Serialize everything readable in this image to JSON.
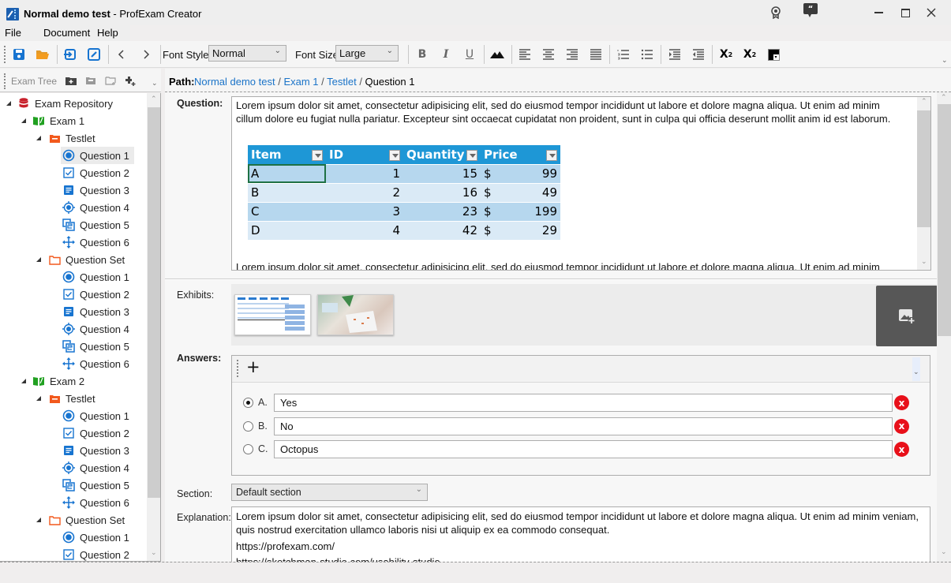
{
  "window": {
    "title_doc": "Normal demo test",
    "title_app": " - ProfExam Creator"
  },
  "menu": [
    "File",
    "Document",
    "Help"
  ],
  "toolbar": {
    "font_style_label": "Font Style:",
    "font_style_value": "Normal",
    "font_size_label": "Font Size:",
    "font_size_value": "Large",
    "bold": "B",
    "italic": "I",
    "underline": "U",
    "subscript": "X",
    "subscript_sub": "2",
    "superscript": "X",
    "superscript_sup": "2"
  },
  "left_panel": {
    "title": "Exam Tree"
  },
  "tree": [
    {
      "label": "Exam Repository",
      "level": 0,
      "icon": "database-icon",
      "expanded": true
    },
    {
      "label": "Exam 1",
      "level": 1,
      "icon": "book-icon",
      "expanded": true
    },
    {
      "label": "Testlet",
      "level": 2,
      "icon": "testlet-folder-icon",
      "expanded": true
    },
    {
      "label": "Question 1",
      "level": 3,
      "icon": "radio-question-icon",
      "selected": true
    },
    {
      "label": "Question 2",
      "level": 3,
      "icon": "checkbox-question-icon"
    },
    {
      "label": "Question 3",
      "level": 3,
      "icon": "text-question-icon"
    },
    {
      "label": "Question 4",
      "level": 3,
      "icon": "hotspot-question-icon"
    },
    {
      "label": "Question 5",
      "level": 3,
      "icon": "match-question-icon"
    },
    {
      "label": "Question 6",
      "level": 3,
      "icon": "drag-drop-question-icon"
    },
    {
      "label": "Question Set",
      "level": 2,
      "icon": "folder-outline-icon",
      "expanded": true
    },
    {
      "label": "Question 1",
      "level": 3,
      "icon": "radio-question-icon"
    },
    {
      "label": "Question 2",
      "level": 3,
      "icon": "checkbox-question-icon"
    },
    {
      "label": "Question 3",
      "level": 3,
      "icon": "text-question-icon"
    },
    {
      "label": "Question 4",
      "level": 3,
      "icon": "hotspot-question-icon"
    },
    {
      "label": "Question 5",
      "level": 3,
      "icon": "match-question-icon"
    },
    {
      "label": "Question 6",
      "level": 3,
      "icon": "drag-drop-question-icon"
    },
    {
      "label": "Exam 2",
      "level": 1,
      "icon": "book-icon",
      "expanded": true
    },
    {
      "label": "Testlet",
      "level": 2,
      "icon": "testlet-folder-icon",
      "expanded": true
    },
    {
      "label": "Question 1",
      "level": 3,
      "icon": "radio-question-icon"
    },
    {
      "label": "Question 2",
      "level": 3,
      "icon": "checkbox-question-icon"
    },
    {
      "label": "Question 3",
      "level": 3,
      "icon": "text-question-icon"
    },
    {
      "label": "Question 4",
      "level": 3,
      "icon": "hotspot-question-icon"
    },
    {
      "label": "Question 5",
      "level": 3,
      "icon": "match-question-icon"
    },
    {
      "label": "Question 6",
      "level": 3,
      "icon": "drag-drop-question-icon"
    },
    {
      "label": "Question Set",
      "level": 2,
      "icon": "folder-outline-icon",
      "expanded": true
    },
    {
      "label": "Question 1",
      "level": 3,
      "icon": "radio-question-icon"
    },
    {
      "label": "Question 2",
      "level": 3,
      "icon": "checkbox-question-icon"
    }
  ],
  "path": {
    "label": "Path:",
    "crumbs": [
      "Normal demo test",
      "Exam 1",
      "Testlet"
    ],
    "current": "Question 1",
    "sep": " / "
  },
  "question": {
    "label": "Question:",
    "line1": "Lorem ipsum dolor sit amet, consectetur adipisicing elit, sed do eiusmod tempor incididunt ut labore et dolore magna aliqua. Ut enim ad minim",
    "line2": "cillum dolore eu fugiat nulla pariatur. Excepteur sint occaecat cupidatat non proident, sunt in culpa qui officia deserunt mollit anim id est laborum.",
    "line3": "Lorem ipsum dolor sit amet, consectetur adipisicing elit, sed do eiusmod tempor incididunt ut labore et dolore magna aliqua. Ut enim ad minim",
    "table": {
      "headers": [
        "Item",
        "ID",
        "Quantity",
        "Price"
      ],
      "rows": [
        [
          "A",
          "1",
          "15",
          "$",
          "99"
        ],
        [
          "B",
          "2",
          "16",
          "$",
          "49"
        ],
        [
          "C",
          "3",
          "23",
          "$",
          "199"
        ],
        [
          "D",
          "4",
          "42",
          "$",
          "29"
        ]
      ]
    }
  },
  "exhibits": {
    "label": "Exhibits:",
    "items": [
      "spreadsheet-exhibit-thumbnail",
      "office-photo-exhibit-thumbnail"
    ]
  },
  "answers": {
    "label": "Answers:",
    "add_label": "+",
    "items": [
      {
        "letter": "A.",
        "text": "Yes",
        "correct": true
      },
      {
        "letter": "B.",
        "text": "No",
        "correct": false
      },
      {
        "letter": "C.",
        "text": "Octopus",
        "correct": false
      }
    ],
    "delete_label": "x"
  },
  "section": {
    "label": "Section:",
    "value": "Default section"
  },
  "explanation": {
    "label": "Explanation:",
    "line1": "Lorem ipsum dolor sit amet, consectetur adipisicing elit, sed do eiusmod tempor incididunt ut labore et dolore magna aliqua. Ut enim ad minim veniam,",
    "line2": "quis nostrud exercitation ullamco laboris nisi ut aliquip ex ea commodo consequat.",
    "link1": "https://profexam.com/",
    "link2": "https://sketchman-studio.com/usability-studio"
  },
  "colors": {
    "accent": "#1a73c8",
    "table_header": "#1e97d6",
    "delete": "#e8101a"
  }
}
